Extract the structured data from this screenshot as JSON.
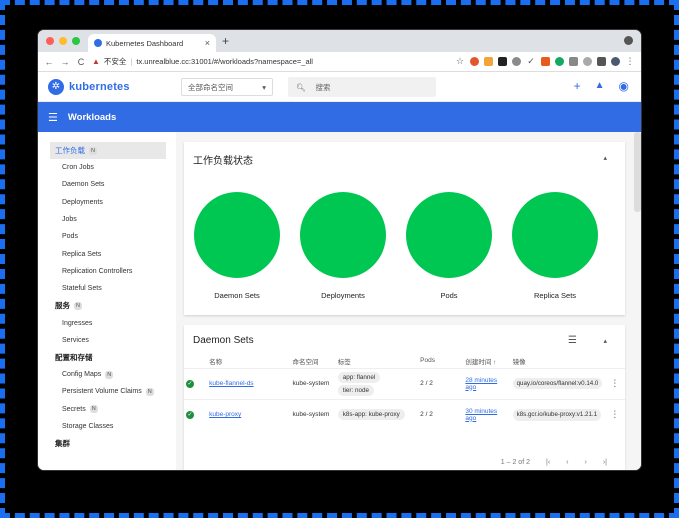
{
  "browser": {
    "tab_title": "Kubernetes Dashboard",
    "tab_close": "×",
    "new_tab": "+",
    "insecure_label": "不安全",
    "url": "tx.unrealblue.cc:31001/#/workloads?namespace=_all"
  },
  "header": {
    "brand": "kubernetes",
    "namespace_select": "全部命名空间",
    "search_placeholder": "搜索",
    "add": "+",
    "bell": "🔔",
    "account": "◉"
  },
  "toolbar": {
    "title": "Workloads"
  },
  "sidebar": {
    "sections": [
      {
        "label": "工作负载",
        "badge": "N",
        "items": [
          "Cron Jobs",
          "Daemon Sets",
          "Deployments",
          "Jobs",
          "Pods",
          "Replica Sets",
          "Replication Controllers",
          "Stateful Sets"
        ]
      },
      {
        "label": "服务",
        "badge": "N",
        "items": [
          "Ingresses",
          "Services"
        ]
      },
      {
        "label": "配置和存储",
        "badge": "",
        "items": [
          "Config Maps",
          "Persistent Volume Claims",
          "Secrets",
          "Storage Classes"
        ]
      },
      {
        "label": "集群",
        "badge": "",
        "items": []
      }
    ],
    "item_badges": {
      "Config Maps": "N",
      "Persistent Volume Claims": "N",
      "Secrets": "N"
    }
  },
  "workload_status": {
    "title": "工作负载状态",
    "collapse": "▴",
    "items": [
      "Daemon Sets",
      "Deployments",
      "Pods",
      "Replica Sets"
    ],
    "status_color": "#00c752"
  },
  "daemon_sets": {
    "title": "Daemon Sets",
    "collapse": "▴",
    "columns": [
      "名称",
      "命名空间",
      "标签",
      "Pods",
      "创建时间 ↑",
      "镜像"
    ],
    "rows": [
      {
        "name": "kube-flannel-ds",
        "namespace": "kube-system",
        "labels": [
          "app: flannel",
          "tier: node"
        ],
        "pods": "2 / 2",
        "created": "28 minutes ago",
        "image": "quay.io/coreos/flannel:v0.14.0"
      },
      {
        "name": "kube-proxy",
        "namespace": "kube-system",
        "labels": [
          "k8s-app: kube-proxy"
        ],
        "pods": "2 / 2",
        "created": "30 minutes ago",
        "image": "k8s.gcr.io/kube-proxy:v1.21.1"
      }
    ],
    "pagination": "1 – 2 of 2"
  }
}
